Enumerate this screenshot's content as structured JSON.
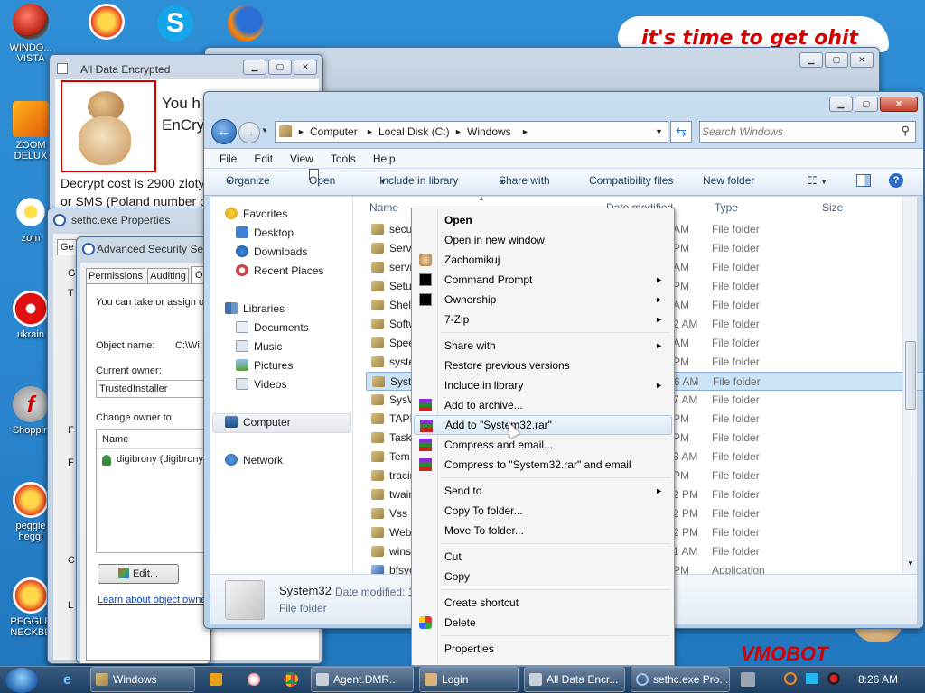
{
  "desktop_icons": [
    {
      "label": "WINDO...\nVISTA",
      "icon": "windows-vista-icon"
    },
    {
      "label": "",
      "icon": "peggle-icon"
    },
    {
      "label": "",
      "icon": "skype-icon"
    },
    {
      "label": "",
      "icon": "firefox-icon"
    },
    {
      "label": "ZOOM\nDELUX",
      "icon": "zoom-icon"
    },
    {
      "label": "zom",
      "icon": "flower-icon"
    },
    {
      "label": "ukrain",
      "icon": "radiation-icon"
    },
    {
      "label": "Shoppin",
      "icon": "flash-icon"
    },
    {
      "label": "peggle\nheggi",
      "icon": "peggle-icon"
    },
    {
      "label": "PEGGLE\nNECKBE",
      "icon": "peggle-icon"
    }
  ],
  "banner_text": "it's time to get ohit",
  "bottom_banner_text": "VMOBOT",
  "ransom_window": {
    "title": "All Data Encrypted",
    "line1": "You h",
    "line2": "EnCry",
    "cost_line": "Decrypt cost is 2900 zloty",
    "sms_line": "or SMS (Poland number o"
  },
  "props_window": {
    "title": "sethc.exe Properties",
    "tab": "Ge"
  },
  "advsec_window": {
    "title": "Advanced Security Set",
    "tabs": [
      "Permissions",
      "Auditing",
      "O"
    ],
    "intro": "You can take or assign o",
    "object_name_label": "Object name:",
    "object_name_value": "C:\\Wi",
    "current_owner_label": "Current owner:",
    "current_owner_value": "TrustedInstaller",
    "change_owner_label": "Change owner to:",
    "name_column": "Name",
    "owner_item": "digibrony (digibrony-",
    "edit_button": "Edit...",
    "learn_link": "Learn about object owne"
  },
  "back_window_letters": [
    "G",
    "T",
    "F",
    "F",
    "C",
    "L"
  ],
  "explorer": {
    "breadcrumb": [
      "Computer",
      "Local Disk (C:)",
      "Windows"
    ],
    "search_placeholder": "Search Windows",
    "menu": [
      "File",
      "Edit",
      "View",
      "Tools",
      "Help"
    ],
    "toolbar": {
      "organize": "Organize",
      "open": "Open",
      "include": "Include in library",
      "share": "Share with",
      "compat": "Compatibility files",
      "newfolder": "New folder"
    },
    "nav": {
      "favorites": "Favorites",
      "desktop": "Desktop",
      "downloads": "Downloads",
      "recent": "Recent Places",
      "libraries": "Libraries",
      "documents": "Documents",
      "music": "Music",
      "pictures": "Pictures",
      "videos": "Videos",
      "computer": "Computer",
      "network": "Network"
    },
    "columns": {
      "name": "Name",
      "date": "Date modified",
      "type": "Type",
      "size": "Size"
    },
    "rows": [
      {
        "name": "secu",
        "date": "AM",
        "type": "File folder"
      },
      {
        "name": "Servi",
        "date": "PM",
        "type": "File folder"
      },
      {
        "name": "servi",
        "date": "AM",
        "type": "File folder"
      },
      {
        "name": "Setup",
        "date": "PM",
        "type": "File folder"
      },
      {
        "name": "Shell",
        "date": "AM",
        "type": "File folder"
      },
      {
        "name": "Softw",
        "date": "2 AM",
        "type": "File folder"
      },
      {
        "name": "Spee",
        "date": "AM",
        "type": "File folder"
      },
      {
        "name": "syste",
        "date": "PM",
        "type": "File folder"
      },
      {
        "name": "Syste",
        "date": "6 AM",
        "type": "File folder",
        "selected": true
      },
      {
        "name": "SysW",
        "date": "7 AM",
        "type": "File folder"
      },
      {
        "name": "TAPI",
        "date": "PM",
        "type": "File folder"
      },
      {
        "name": "Task",
        "date": "PM",
        "type": "File folder"
      },
      {
        "name": "Tem",
        "date": "3 AM",
        "type": "File folder"
      },
      {
        "name": "tracin",
        "date": "PM",
        "type": "File folder"
      },
      {
        "name": "twain",
        "date": "2 PM",
        "type": "File folder"
      },
      {
        "name": "Vss",
        "date": "2 PM",
        "type": "File folder"
      },
      {
        "name": "Web",
        "date": "2 PM",
        "type": "File folder"
      },
      {
        "name": "winsx",
        "date": "1 AM",
        "type": "File folder"
      },
      {
        "name": "bfsvc",
        "date": "PM",
        "type": "Application"
      }
    ],
    "details": {
      "name": "System32",
      "date_label": "Date modified: 1",
      "type": "File folder"
    }
  },
  "context_menu": {
    "items": [
      {
        "label": "Open",
        "bold": true
      },
      {
        "label": "Open in new window"
      },
      {
        "label": "Zachomikuj",
        "icon": "hamster-icon"
      },
      {
        "label": "Command Prompt",
        "icon": "cmd-icon",
        "submenu": true
      },
      {
        "label": "Ownership",
        "icon": "cmd-icon",
        "submenu": true
      },
      {
        "label": "7-Zip",
        "submenu": true
      },
      {
        "sep": true
      },
      {
        "label": "Share with",
        "submenu": true
      },
      {
        "label": "Restore previous versions"
      },
      {
        "label": "Include in library",
        "submenu": true
      },
      {
        "label": "Add to archive...",
        "icon": "winrar-icon"
      },
      {
        "label": "Add to \"System32.rar\"",
        "icon": "winrar-icon",
        "hover": true
      },
      {
        "label": "Compress and email...",
        "icon": "winrar-icon"
      },
      {
        "label": "Compress to \"System32.rar\" and email",
        "icon": "winrar-icon"
      },
      {
        "sep": true
      },
      {
        "label": "Send to",
        "submenu": true
      },
      {
        "label": "Copy To folder..."
      },
      {
        "label": "Move To folder..."
      },
      {
        "sep": true
      },
      {
        "label": "Cut"
      },
      {
        "label": "Copy"
      },
      {
        "sep": true
      },
      {
        "label": "Create shortcut"
      },
      {
        "label": "Delete",
        "icon": "shield-icon"
      },
      {
        "sep": true
      },
      {
        "label": "Properties"
      }
    ]
  },
  "taskbar": {
    "buttons": [
      "Windows",
      "Agent.DMR...",
      "Login",
      "All Data Encr...",
      "sethc.exe Pro..."
    ],
    "clock": "8:26 AM"
  },
  "colors": {
    "accent": "#3b9bd6",
    "selection": "#cce4f7",
    "taskbar": "#1c3e62"
  }
}
